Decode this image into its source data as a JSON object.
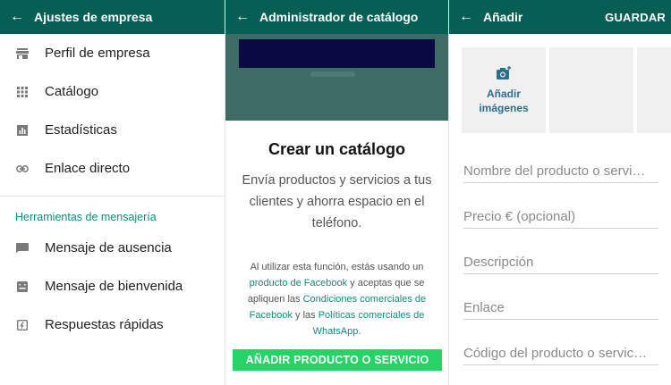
{
  "panel1": {
    "title": "Ajustes de empresa",
    "items": [
      {
        "label": "Perfil de empresa",
        "icon": "store-icon"
      },
      {
        "label": "Catálogo",
        "icon": "grid-icon"
      },
      {
        "label": "Estadísticas",
        "icon": "bar-chart-icon"
      },
      {
        "label": "Enlace directo",
        "icon": "link-icon"
      }
    ],
    "section_title": "Herramientas de mensajería",
    "tools": [
      {
        "label": "Mensaje de ausencia",
        "icon": "away-message-icon"
      },
      {
        "label": "Mensaje de bienvenida",
        "icon": "greeting-message-icon"
      },
      {
        "label": "Respuestas rápidas",
        "icon": "quick-reply-icon"
      }
    ]
  },
  "panel2": {
    "title": "Administrador de catálogo",
    "heading": "Crear un catálogo",
    "description": "Envía productos y servicios a tus clientes y ahorra espacio en el teléfono.",
    "legal": {
      "part1": "Al utilizar esta función, estás usando un ",
      "link1": "producto de Facebook",
      "part2": " y aceptas que se apliquen las ",
      "link2": "Condiciones comerciales de Facebook",
      "part3": " y las ",
      "link3": "Políticas comerciales de WhatsApp",
      "part4": "."
    },
    "button": "AÑADIR PRODUCTO O SERVICIO"
  },
  "panel3": {
    "title": "Añadir",
    "save": "GUARDAR",
    "add_images_1": "Añadir",
    "add_images_2": "imágenes",
    "fields": {
      "name": "Nombre del producto o servi…",
      "price": "Precio € (opcional)",
      "description": "Descripción",
      "link": "Enlace",
      "code": "Código del producto o servic…"
    }
  },
  "colors": {
    "appbar": "#075e54",
    "accent": "#128c7e",
    "button": "#25d366",
    "banner": "#3e6b65"
  }
}
